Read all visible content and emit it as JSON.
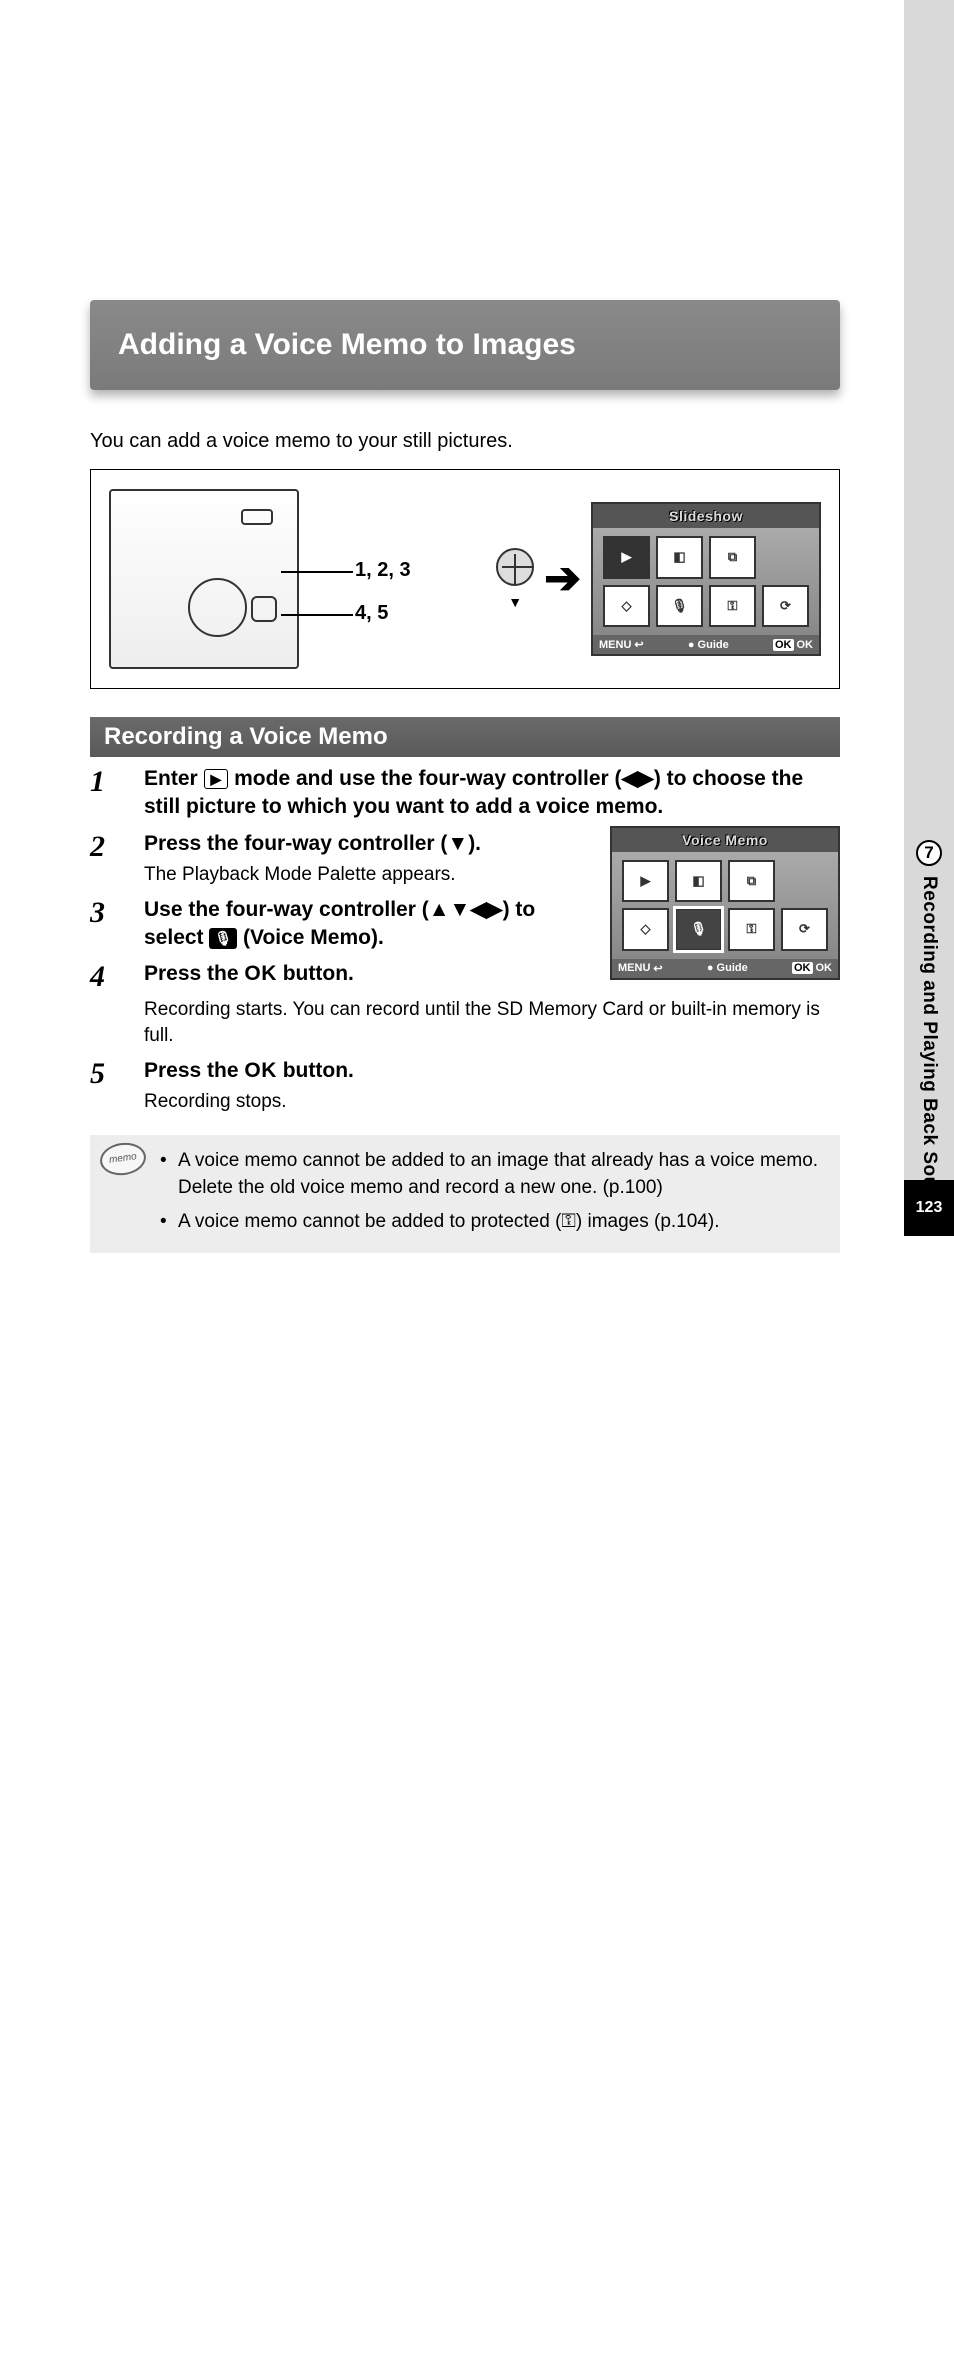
{
  "title": "Adding a Voice Memo to Images",
  "intro": "You can add a voice memo to your still pictures.",
  "callouts": {
    "line1": "1, 2, 3",
    "line2": "4, 5"
  },
  "lcd1": {
    "title": "Slideshow",
    "icons": [
      "▶",
      "◧",
      "⧉",
      "⬚",
      "◇",
      "🎙",
      "⚿",
      "⟳"
    ],
    "footer": {
      "menu": "MENU",
      "menu_icon": "↩",
      "guide_dot": "●",
      "guide": "Guide",
      "ok_box": "OK",
      "ok": "OK"
    }
  },
  "subtitle": "Recording a Voice Memo",
  "steps": [
    {
      "num": "1",
      "head_parts": [
        "Enter ",
        " mode and use the four-way controller (◀▶) to choose the still picture to which you want to add a voice memo."
      ],
      "mode_icon": "▶"
    },
    {
      "num": "2",
      "head": "Press the four-way controller (▼).",
      "desc": "The Playback Mode Palette appears."
    },
    {
      "num": "3",
      "head_parts": [
        "Use the four-way controller (▲▼◀▶) to select ",
        " (Voice Memo)."
      ],
      "mic_icon": "🎙"
    },
    {
      "num": "4",
      "head_parts": [
        "Press the ",
        " button."
      ],
      "ok_text": "OK",
      "desc": "Recording starts. You can record until the SD Memory Card or built-in memory is full."
    },
    {
      "num": "5",
      "head_parts": [
        "Press the ",
        " button."
      ],
      "ok_text": "OK",
      "desc": "Recording stops."
    }
  ],
  "lcd2": {
    "title": "Voice Memo",
    "icons": [
      "▶",
      "◧",
      "⧉",
      "⬚",
      "◇",
      "🎙",
      "⚿",
      "⟳"
    ],
    "footer": {
      "menu": "MENU",
      "menu_icon": "↩",
      "guide_dot": "●",
      "guide": "Guide",
      "ok_box": "OK",
      "ok": "OK"
    }
  },
  "memo_label": "memo",
  "memo": [
    "A voice memo cannot be added to an image that already has a voice memo. Delete the old voice memo and record a new one. (p.100)",
    "A voice memo cannot be added to protected (⚿) images (p.104)."
  ],
  "side": {
    "chapter": "7",
    "label": "Recording and Playing Back Sound"
  },
  "page": "123"
}
